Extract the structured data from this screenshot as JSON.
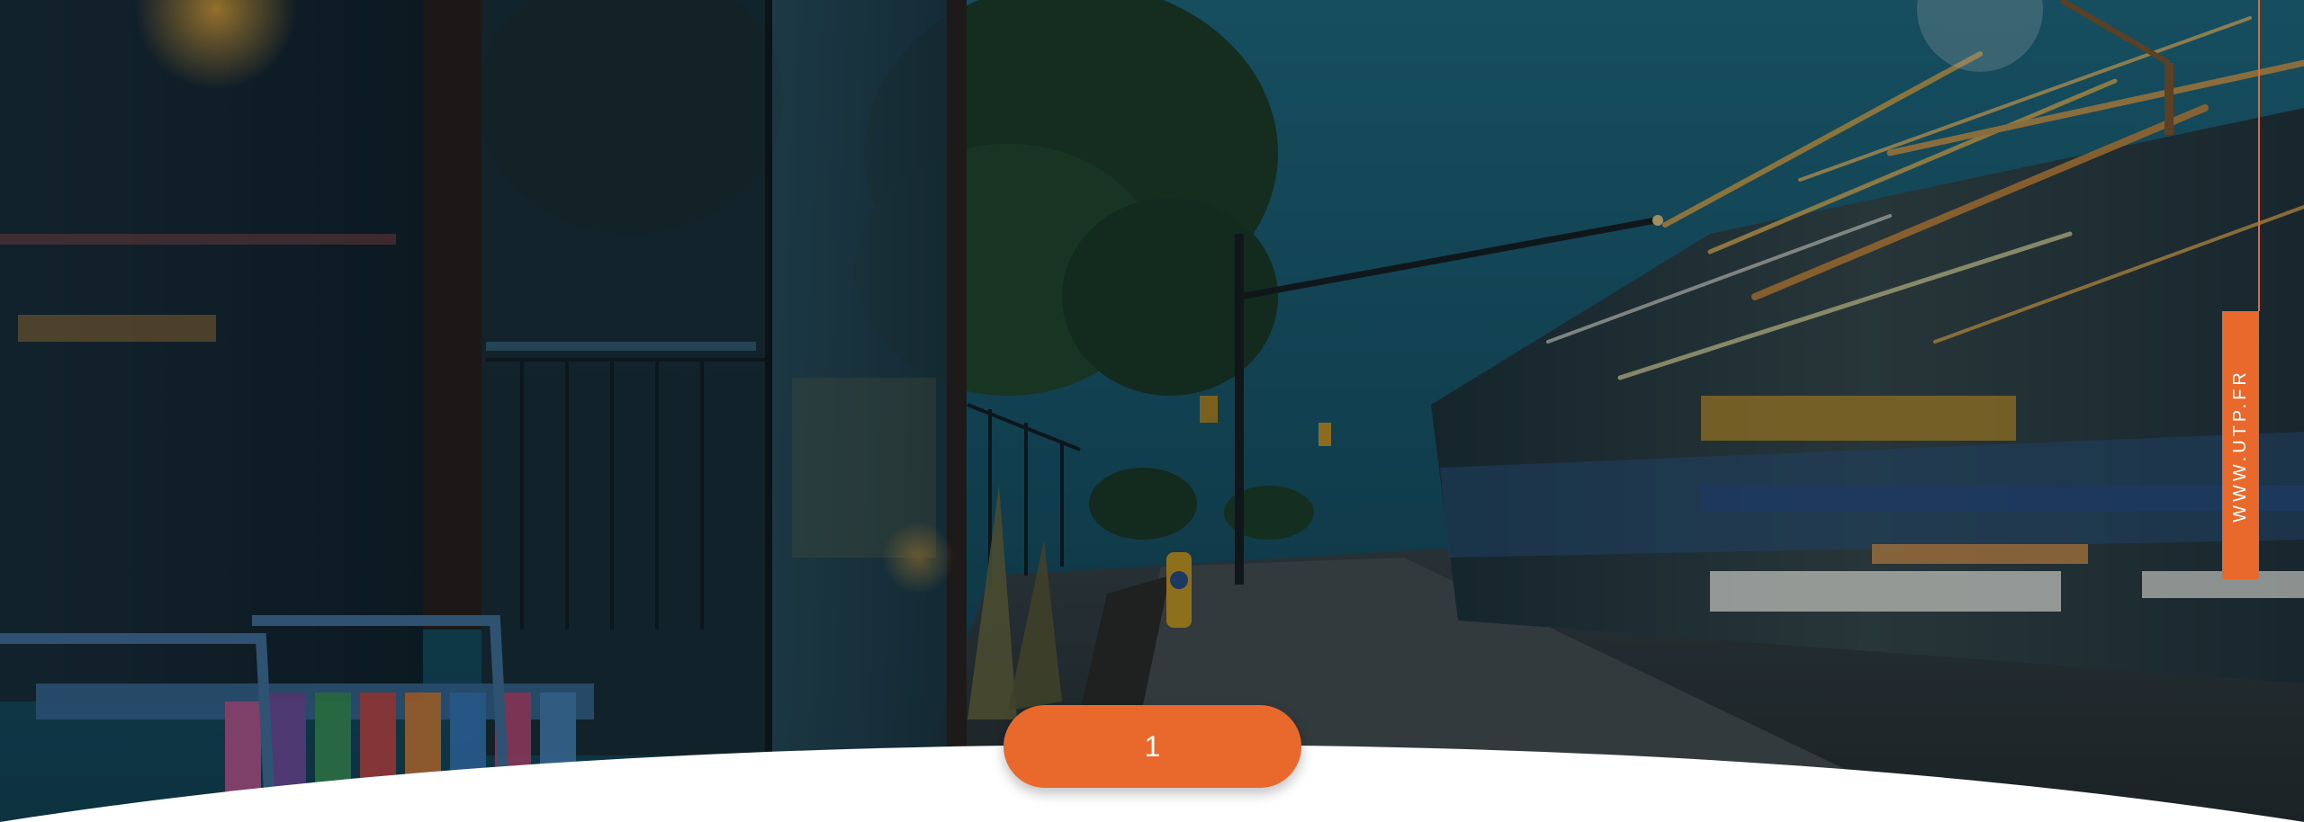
{
  "page": {
    "number": "1"
  },
  "sidebar": {
    "url_label": "WWW.UTP.FR"
  },
  "colors": {
    "accent": "#e9692c",
    "background": "#ffffff"
  },
  "scene": {
    "icon": "street-scene-photo"
  }
}
